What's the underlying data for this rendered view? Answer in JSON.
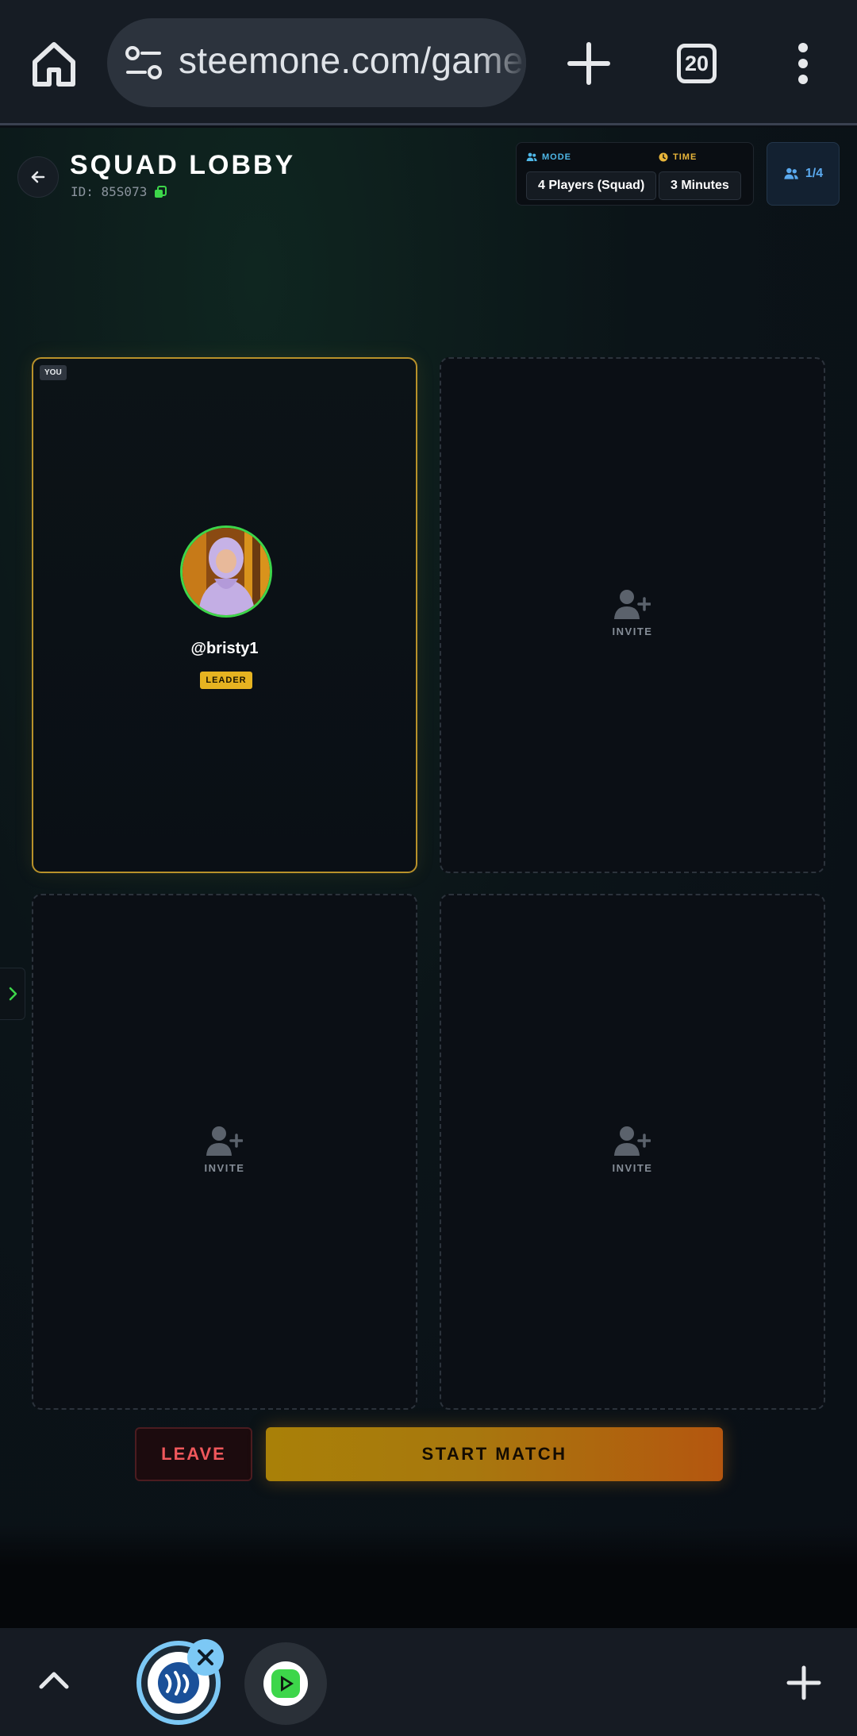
{
  "browser": {
    "url": "steemone.com/game",
    "tab_count": "20"
  },
  "lobby": {
    "title": "SQUAD LOBBY",
    "id_text": "ID: 85S073",
    "mode_label": "MODE",
    "mode_value": "4 Players (Squad)",
    "time_label": "TIME",
    "time_value": "3 Minutes",
    "player_count": "1/4"
  },
  "slots": [
    {
      "badge": "YOU",
      "name": "@bristy1",
      "role": "LEADER"
    },
    {
      "invite_label": "INVITE"
    },
    {
      "invite_label": "INVITE"
    },
    {
      "invite_label": "INVITE"
    }
  ],
  "actions": {
    "leave": "LEAVE",
    "start": "START MATCH"
  },
  "colors": {
    "accent_gold": "#e6b321",
    "leave_red": "#f0585c",
    "mode_blue": "#4fb8e8",
    "online_green": "#3dd64a"
  },
  "icons": {
    "home": "home-icon",
    "tune": "tune-icon",
    "new_tab": "plus-icon",
    "menu": "more-vert-icon",
    "back": "arrow-left-icon",
    "copy": "copy-icon",
    "users": "users-icon",
    "clock": "clock-icon",
    "invite": "user-plus-icon",
    "side": "chevron-right-icon",
    "expand": "chevron-up-icon",
    "close": "close-icon",
    "add": "plus-icon"
  }
}
